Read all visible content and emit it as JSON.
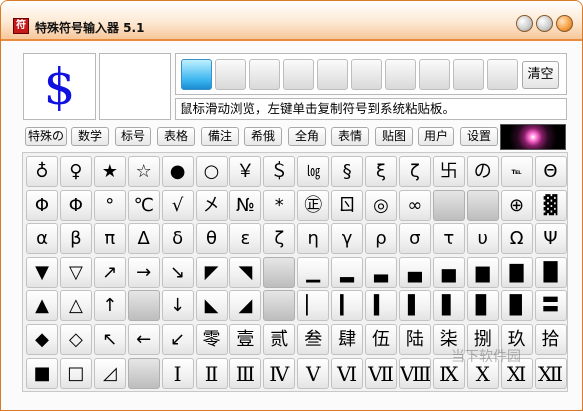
{
  "window": {
    "title": "特殊符号输入器 5.1"
  },
  "preview": {
    "symbol": "$"
  },
  "toolbar": {
    "clear_label": "清空",
    "hint": "鼠标滑动浏览，左键单击复制符号到系统粘贴板。"
  },
  "tabs": [
    "特殊の",
    "数学",
    "标号",
    "表格",
    "備注",
    "希俄",
    "全角",
    "表情",
    "贴图",
    "用户",
    "设置"
  ],
  "grid": [
    [
      "♁",
      "♀",
      "★",
      "☆",
      "●",
      "○",
      "￥",
      "＄",
      "㏒",
      "§",
      "ξ",
      "ζ",
      "卐",
      "の",
      "℡",
      "Θ"
    ],
    [
      "Φ",
      "Φ",
      "°",
      "℃",
      "√",
      "㐅",
      "№",
      "*",
      "㊣",
      "ㄖ",
      "◎",
      "∞",
      "",
      "",
      "⊕",
      "▓"
    ],
    [
      "α",
      "β",
      "π",
      "Δ",
      "δ",
      "θ",
      "ε",
      "ζ",
      "η",
      "γ",
      "ρ",
      "σ",
      "τ",
      "υ",
      "Ω",
      "Ψ"
    ],
    [
      "▼",
      "▽",
      "↗",
      "→",
      "↘",
      "◤",
      "◥",
      "",
      "▁",
      "▂",
      "▃",
      "▄",
      "▅",
      "▆",
      "▇",
      "█"
    ],
    [
      "▲",
      "△",
      "↑",
      "",
      "↓",
      "◣",
      "◢",
      "",
      "▏",
      "▎",
      "▍",
      "▌",
      "▋",
      "▊",
      "▉",
      "〓"
    ],
    [
      "◆",
      "◇",
      "↖",
      "←",
      "↙",
      "零",
      "壹",
      "贰",
      "叁",
      "肆",
      "伍",
      "陆",
      "柒",
      "捌",
      "玖",
      "拾"
    ],
    [
      "■",
      "□",
      "◿",
      "",
      "Ⅰ",
      "Ⅱ",
      "Ⅲ",
      "Ⅳ",
      "Ⅴ",
      "Ⅵ",
      "Ⅶ",
      "Ⅷ",
      "Ⅸ",
      "Ⅹ",
      "Ⅺ",
      "Ⅻ"
    ]
  ],
  "watermark": "当下软件园"
}
